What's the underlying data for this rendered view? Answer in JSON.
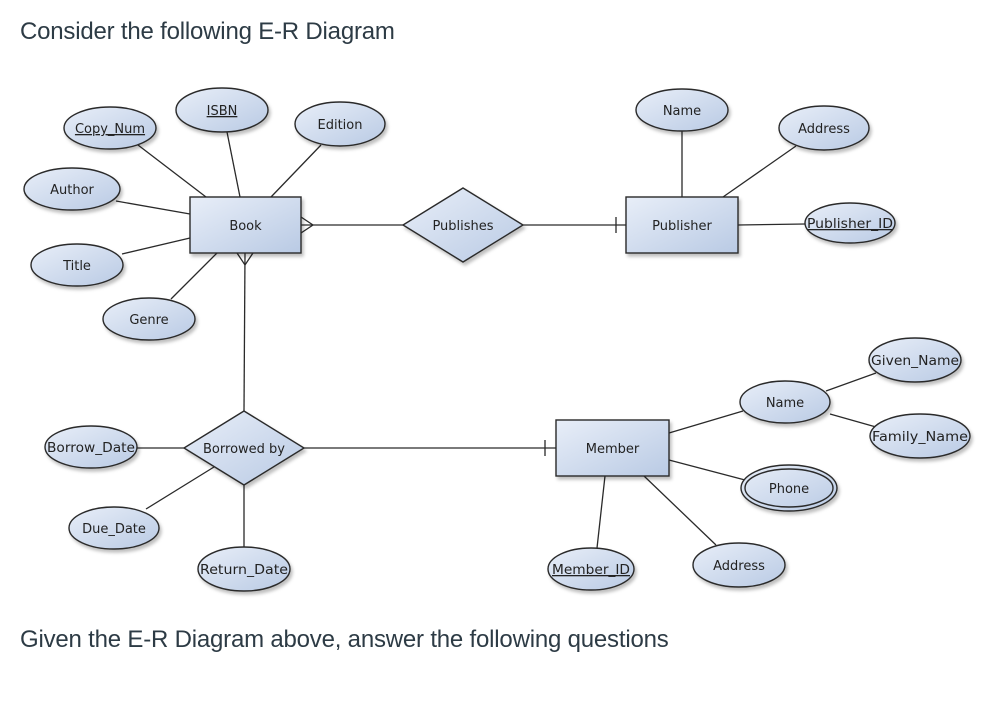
{
  "headings": {
    "top": "Consider the following E-R Diagram",
    "bottom": "Given the E-R Diagram above, answer the following questions"
  },
  "diagram": {
    "colors": {
      "fill_light": "#e8eef8",
      "fill_dark": "#b9cae4",
      "stroke": "#2a2a2a"
    },
    "entities": [
      {
        "id": "book",
        "label": "Book"
      },
      {
        "id": "publisher",
        "label": "Publisher"
      },
      {
        "id": "member",
        "label": "Member"
      }
    ],
    "relationships": [
      {
        "id": "publishes",
        "label": "Publishes"
      },
      {
        "id": "borrowed_by",
        "label": "Borrowed by"
      }
    ],
    "attributes": [
      {
        "id": "copy_num",
        "label": "Copy_Num",
        "owner": "book",
        "key": true,
        "multivalued": false
      },
      {
        "id": "isbn",
        "label": "ISBN",
        "owner": "book",
        "key": true,
        "multivalued": false
      },
      {
        "id": "edition",
        "label": "Edition",
        "owner": "book",
        "key": false,
        "multivalued": false
      },
      {
        "id": "author",
        "label": "Author",
        "owner": "book",
        "key": false,
        "multivalued": false
      },
      {
        "id": "title",
        "label": "Title",
        "owner": "book",
        "key": false,
        "multivalued": false
      },
      {
        "id": "genre",
        "label": "Genre",
        "owner": "book",
        "key": false,
        "multivalued": false
      },
      {
        "id": "pub_name",
        "label": "Name",
        "owner": "publisher",
        "key": false,
        "multivalued": false
      },
      {
        "id": "pub_address",
        "label": "Address",
        "owner": "publisher",
        "key": false,
        "multivalued": false
      },
      {
        "id": "publisher_id",
        "label": "Publisher_ID",
        "owner": "publisher",
        "key": true,
        "multivalued": false
      },
      {
        "id": "borrow_date",
        "label": "Borrow_Date",
        "owner": "borrowed_by",
        "key": false,
        "multivalued": false
      },
      {
        "id": "due_date",
        "label": "Due_Date",
        "owner": "borrowed_by",
        "key": false,
        "multivalued": false
      },
      {
        "id": "return_date",
        "label": "Return_Date",
        "owner": "borrowed_by",
        "key": false,
        "multivalued": false
      },
      {
        "id": "mem_name",
        "label": "Name",
        "owner": "member",
        "key": false,
        "multivalued": false
      },
      {
        "id": "given_name",
        "label": "Given_Name",
        "owner": "mem_name",
        "key": false,
        "multivalued": false
      },
      {
        "id": "family_name",
        "label": "Family_Name",
        "owner": "mem_name",
        "key": false,
        "multivalued": false
      },
      {
        "id": "phone",
        "label": "Phone",
        "owner": "member",
        "key": false,
        "multivalued": true
      },
      {
        "id": "member_id",
        "label": "Member_ID",
        "owner": "member",
        "key": true,
        "multivalued": false
      },
      {
        "id": "mem_address",
        "label": "Address",
        "owner": "member",
        "key": false,
        "multivalued": false
      }
    ],
    "links": [
      {
        "from": "book",
        "to": "publishes",
        "cardinality_at_from": "many"
      },
      {
        "from": "publishes",
        "to": "publisher",
        "cardinality_at_to": "one"
      },
      {
        "from": "book",
        "to": "borrowed_by",
        "cardinality_at_from": "many"
      },
      {
        "from": "borrowed_by",
        "to": "member",
        "cardinality_at_to": "one"
      }
    ]
  }
}
